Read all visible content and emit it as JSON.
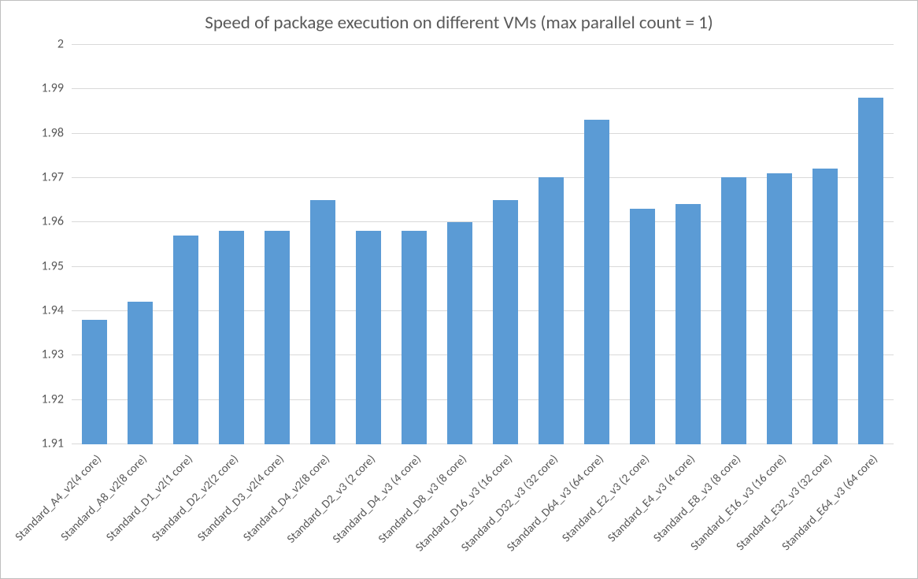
{
  "chart_data": {
    "type": "bar",
    "title": "Speed of package execution on different VMs (max parallel count = 1)",
    "xlabel": "",
    "ylabel": "",
    "ylim": [
      1.91,
      2.0
    ],
    "yticks": [
      1.91,
      1.92,
      1.93,
      1.94,
      1.95,
      1.96,
      1.97,
      1.98,
      1.99,
      2.0
    ],
    "categories": [
      "Standard_A4_v2(4 core)",
      "Standard_A8_v2(8 core)",
      "Standard_D1_v2(1 core)",
      "Standard_D2_v2(2 core)",
      "Standard_D3_v2(4 core)",
      "Standard_D4_v2(8 core)",
      "Standard_D2_v3 (2 core)",
      "Standard_D4_v3 (4 core)",
      "Standard_D8_v3 (8 core)",
      "Standard_D16_v3 (16 core)",
      "Standard_D32_v3 (32 core)",
      "Standard_D64_v3 (64 core)",
      "Standard_E2_v3 (2 core)",
      "Standard_E4_v3 (4 core)",
      "Standard_E8_v3 (8 core)",
      "Standard_E16_v3 (16 core)",
      "Standard_E32_v3 (32 core)",
      "Standard_E64_v3 (64 core)"
    ],
    "values": [
      1.938,
      1.942,
      1.957,
      1.958,
      1.958,
      1.965,
      1.958,
      1.958,
      1.96,
      1.965,
      1.97,
      1.983,
      1.963,
      1.964,
      1.97,
      1.971,
      1.972,
      1.988
    ],
    "bar_color": "#5b9bd5",
    "grid_color": "#d9d9d9"
  }
}
